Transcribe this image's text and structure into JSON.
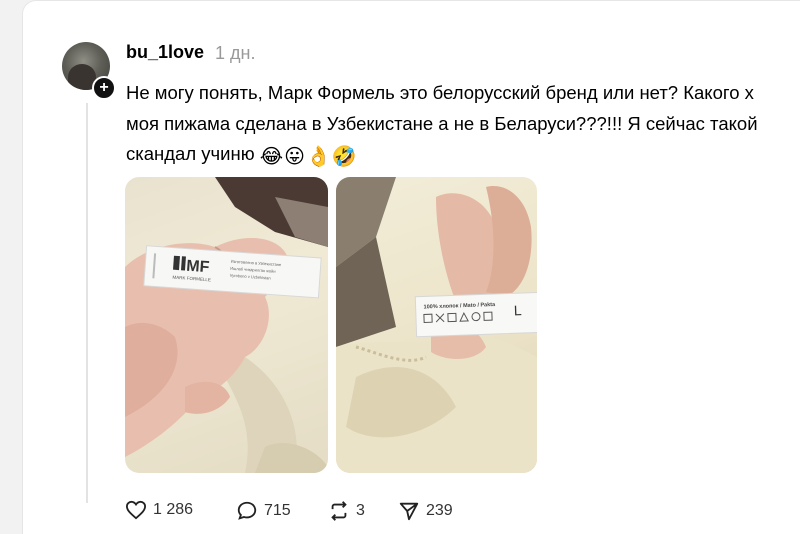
{
  "post": {
    "username": "bu_1love",
    "time": "1 дн.",
    "lines": [
      "Не могу понять, Марк Формель это белорусский бренд или нет? Какого х",
      "моя пижама сделана в Узбекистане а не в Беларуси???!!! Я сейчас такой",
      "скандал учиню"
    ],
    "emojis": [
      "😂",
      "😛",
      "👌",
      "🤣"
    ]
  },
  "photo1": {
    "brand_mark": "MF",
    "brand_name": "MARK FORMELLE",
    "tag_lines": [
      "Изготовлено в Узбекистане",
      "Ишлаб чиқарилган жойи",
      "Vyrobeno v Uzbekistan"
    ]
  },
  "photo2": {
    "composition": "100% хлопок / Mato / Pakta",
    "size": "L"
  },
  "actions": {
    "likes": "1 286",
    "replies": "715",
    "reposts": "3",
    "shares": "239"
  },
  "colors": {
    "background": "#ffffff",
    "muted": "#999999"
  }
}
